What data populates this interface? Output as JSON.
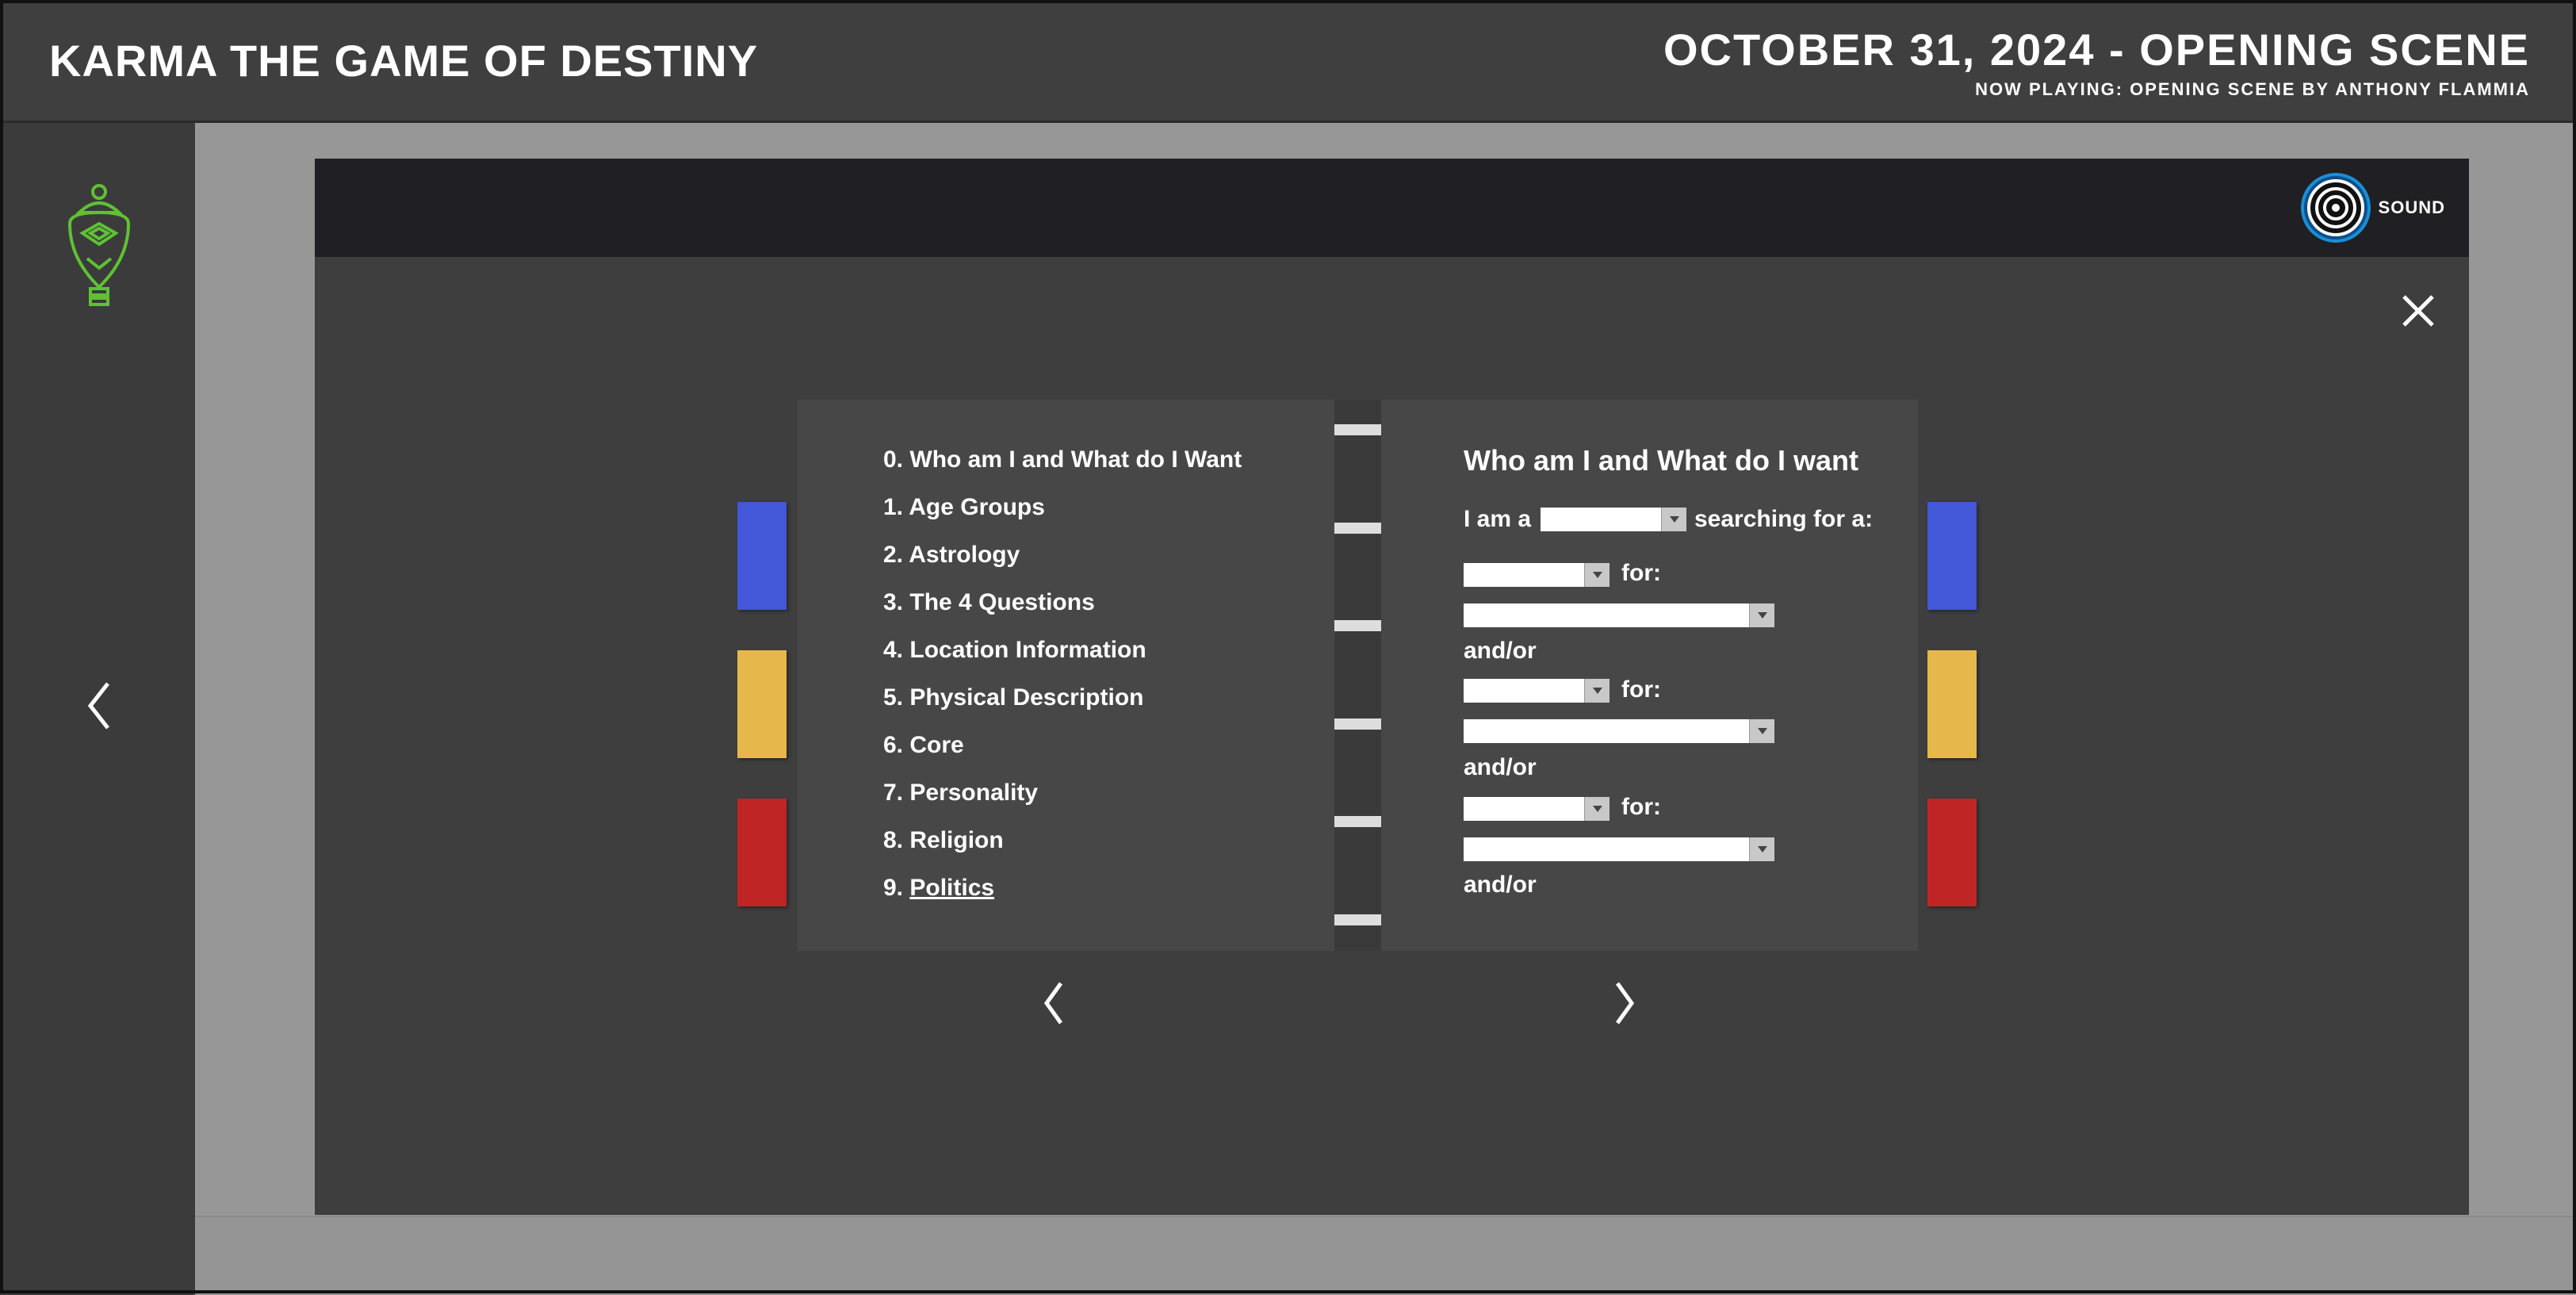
{
  "header": {
    "app_title": "KARMA THE GAME OF DESTINY",
    "date_title": "OCTOBER 31, 2024 - OPENING SCENE",
    "now_playing": "NOW PLAYING: OPENING SCENE BY ANTHONY FLAMMIA"
  },
  "sidebar": {
    "logo_icon": "green-oracle-logo-icon",
    "prev_icon": "chevron-left-icon"
  },
  "modal": {
    "sound_label": "SOUND",
    "sound_icon": "concentric-circles-icon",
    "close_icon": "close-x-icon"
  },
  "colors": {
    "tab_blue": "#4357d9",
    "tab_yellow": "#e6b84c",
    "tab_red": "#c02525",
    "logo_green": "#5ec233",
    "sound_ring": "#1a8fd6"
  },
  "toc": {
    "items": [
      {
        "num": "0.",
        "label": "Who am I and What do I Want"
      },
      {
        "num": "1.",
        "label": "Age Groups"
      },
      {
        "num": "2.",
        "label": "Astrology"
      },
      {
        "num": "3.",
        "label": "The 4 Questions"
      },
      {
        "num": "4.",
        "label": "Location Information"
      },
      {
        "num": "5.",
        "label": "Physical Description"
      },
      {
        "num": "6.",
        "label": "Core"
      },
      {
        "num": "7.",
        "label": "Personality"
      },
      {
        "num": "8.",
        "label": "Religion"
      },
      {
        "num": "9.",
        "label": "Politics"
      }
    ],
    "active_index": 9
  },
  "form": {
    "title": "Who am I and What do I want",
    "i_am_a": "I am a",
    "searching_for": "searching for a:",
    "for_label": "for:",
    "andor_label": "and/or",
    "select_value": ""
  },
  "nav": {
    "prev_icon": "chevron-left-icon",
    "next_icon": "chevron-right-icon"
  }
}
